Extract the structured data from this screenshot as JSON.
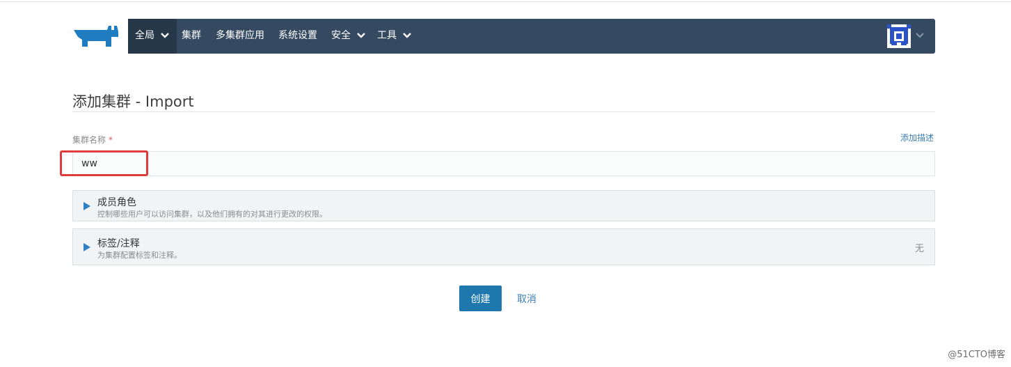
{
  "nav": {
    "items": [
      {
        "label": "全局",
        "dropdown": true,
        "active": true
      },
      {
        "label": "集群",
        "dropdown": false
      },
      {
        "label": "多集群应用",
        "dropdown": false
      },
      {
        "label": "系统设置",
        "dropdown": false
      },
      {
        "label": "安全",
        "dropdown": true
      },
      {
        "label": "工具",
        "dropdown": true
      }
    ],
    "icons": {
      "logo": "rancher-cow-logo",
      "user": "user-avatar",
      "chevron": "chevron-down-icon"
    }
  },
  "page": {
    "title": "添加集群 - Import"
  },
  "form": {
    "name_label": "集群名称",
    "required_mark": "*",
    "add_description": "添加描述",
    "name_value": "ww"
  },
  "sections": [
    {
      "title": "成员角色",
      "subtitle": "控制哪些用户可以访问集群，以及他们拥有的对其进行更改的权限。",
      "status": ""
    },
    {
      "title": "标签/注释",
      "subtitle": "为集群配置标签和注释。",
      "status": "无"
    }
  ],
  "buttons": {
    "create": "创建",
    "cancel": "取消"
  },
  "watermark": "@51CTO博客",
  "colors": {
    "nav_bg": "#354a61",
    "primary": "#1e78ad",
    "link": "#3d7eb5",
    "highlight": "#e03c3c",
    "logo": "#1f7cc0"
  }
}
